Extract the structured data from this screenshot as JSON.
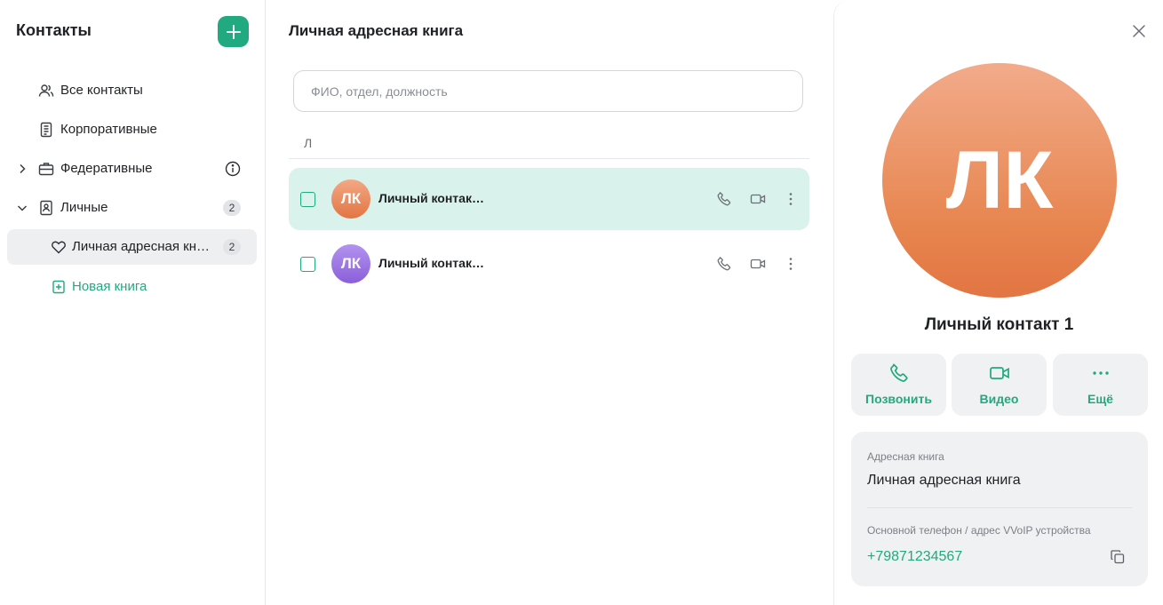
{
  "sidebar": {
    "title": "Контакты",
    "items": [
      {
        "label": "Все контакты"
      },
      {
        "label": "Корпоративные"
      },
      {
        "label": "Федеративные"
      },
      {
        "label": "Личные",
        "badge": "2"
      },
      {
        "label": "Личная адресная кн…",
        "badge": "2"
      },
      {
        "label": "Новая книга"
      }
    ]
  },
  "main": {
    "title": "Личная адресная книга",
    "search_placeholder": "ФИО, отдел, должность",
    "section_letter": "Л",
    "contacts": [
      {
        "initials": "ЛК",
        "name": "Личный контак…",
        "selected": true
      },
      {
        "initials": "ЛК",
        "name": "Личный контак…",
        "selected": false
      }
    ]
  },
  "details": {
    "initials": "ЛК",
    "name": "Личный контакт 1",
    "actions": [
      {
        "label": "Позвонить",
        "icon": "phone-icon"
      },
      {
        "label": "Видео",
        "icon": "video-icon"
      },
      {
        "label": "Ещё",
        "icon": "more-horizontal-icon"
      }
    ],
    "address_book_label": "Адресная книга",
    "address_book_value": "Личная адресная книга",
    "phone_label": "Основной телефон / адрес VVoIP устройства",
    "phone_value": "+79871234567"
  },
  "colors": {
    "accent": "#21a97f",
    "selected_row": "#d9f2ec",
    "avatar_orange": "#e7854f",
    "avatar_purple": "#8a5fd9"
  }
}
